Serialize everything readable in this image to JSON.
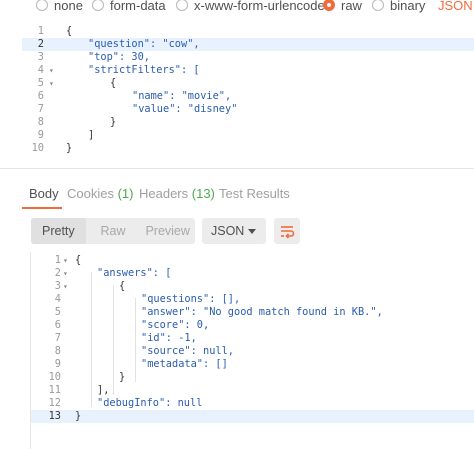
{
  "body_types": [
    {
      "label": "none",
      "selected": false
    },
    {
      "label": "form-data",
      "selected": false
    },
    {
      "label": "x-www-form-urlencoded",
      "selected": false
    },
    {
      "label": "raw",
      "selected": true
    },
    {
      "label": "binary",
      "selected": false
    },
    {
      "label": "JSON (a",
      "selected": false
    }
  ],
  "request": {
    "lines": [
      {
        "n": "1",
        "fold": "",
        "code": "{"
      },
      {
        "n": "2",
        "fold": "",
        "code": "\"question\": \"cow\","
      },
      {
        "n": "3",
        "fold": "",
        "code": "\"top\": 30,"
      },
      {
        "n": "4",
        "fold": "▾",
        "code": "\"strictFilters\": ["
      },
      {
        "n": "5",
        "fold": "▾",
        "code": "{"
      },
      {
        "n": "6",
        "fold": "",
        "code": "\"name\": \"movie\","
      },
      {
        "n": "7",
        "fold": "",
        "code": "\"value\": \"disney\""
      },
      {
        "n": "8",
        "fold": "",
        "code": "}"
      },
      {
        "n": "9",
        "fold": "",
        "code": "]"
      },
      {
        "n": "10",
        "fold": "",
        "code": "}"
      }
    ]
  },
  "response_tabs": [
    {
      "label": "Body",
      "count": ""
    },
    {
      "label": "Cookies",
      "count": "(1)"
    },
    {
      "label": "Headers",
      "count": "(13)"
    },
    {
      "label": "Test Results",
      "count": ""
    }
  ],
  "view_modes": [
    "Pretty",
    "Raw",
    "Preview"
  ],
  "format": "JSON",
  "response": {
    "lines": [
      {
        "n": "1",
        "fold": "▾",
        "code": "{"
      },
      {
        "n": "2",
        "fold": "▾",
        "code": "\"answers\": ["
      },
      {
        "n": "3",
        "fold": "▾",
        "code": "{"
      },
      {
        "n": "4",
        "fold": "",
        "code": "\"questions\": [],"
      },
      {
        "n": "5",
        "fold": "",
        "code": "\"answer\": \"No good match found in KB.\","
      },
      {
        "n": "6",
        "fold": "",
        "code": "\"score\": 0,"
      },
      {
        "n": "7",
        "fold": "",
        "code": "\"id\": -1,"
      },
      {
        "n": "8",
        "fold": "",
        "code": "\"source\": null,"
      },
      {
        "n": "9",
        "fold": "",
        "code": "\"metadata\": []"
      },
      {
        "n": "10",
        "fold": "",
        "code": "}"
      },
      {
        "n": "11",
        "fold": "",
        "code": "],"
      },
      {
        "n": "12",
        "fold": "",
        "code": "\"debugInfo\": null"
      },
      {
        "n": "13",
        "fold": "",
        "code": "}"
      }
    ]
  },
  "colors": {
    "accent": "#f26b3a",
    "json_key": "#2a5db0",
    "count_green": "#4fa84f",
    "active_line": "#e8f2fe"
  }
}
